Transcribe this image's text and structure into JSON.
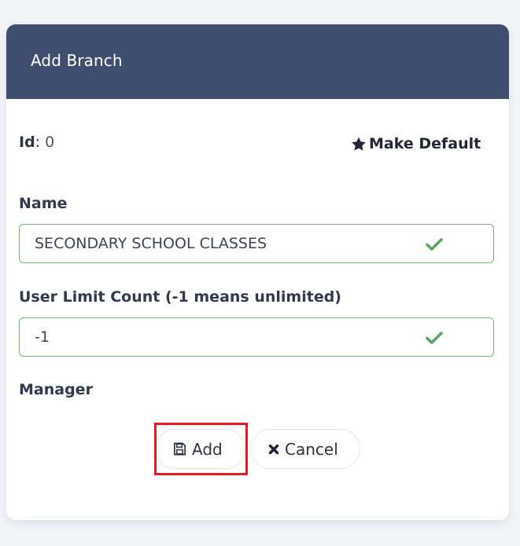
{
  "dialog": {
    "title": "Add Branch"
  },
  "meta": {
    "id_label": "Id",
    "id_separator": ": ",
    "id_value": "0",
    "make_default_label": "Make Default",
    "make_default_icon": "star-icon"
  },
  "form": {
    "name": {
      "label": "Name",
      "value": "SECONDARY SCHOOL CLASSES",
      "status_icon": "check-icon"
    },
    "user_limit": {
      "label": "User Limit Count (-1 means unlimited)",
      "value": "-1",
      "status_icon": "check-icon"
    },
    "manager": {
      "label": "Manager"
    }
  },
  "actions": {
    "add_label": "Add",
    "add_icon": "save-icon",
    "cancel_label": "Cancel",
    "cancel_icon": "close-icon"
  },
  "colors": {
    "header_bg": "#3f4e6e",
    "valid_border": "#6cba6c",
    "check": "#5aa860",
    "highlight": "#e6191c"
  }
}
